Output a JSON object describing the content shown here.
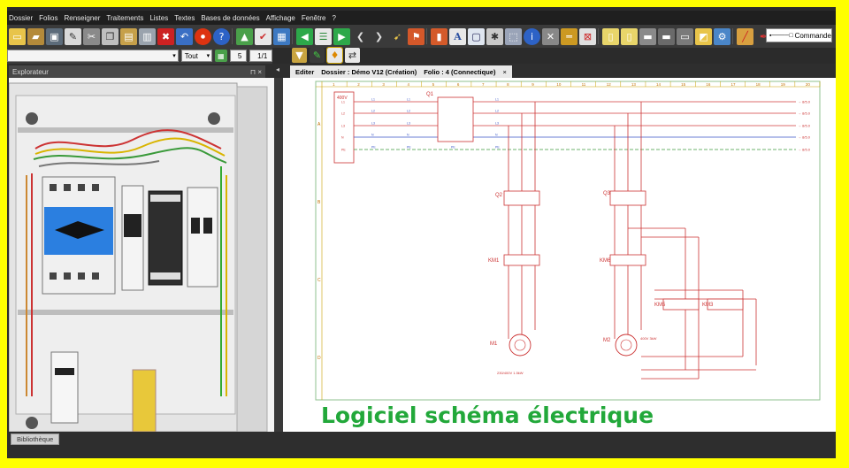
{
  "menu": [
    "Dossier",
    "Folios",
    "Renseigner",
    "Traitements",
    "Listes",
    "Textes",
    "Bases de données",
    "Affichage",
    "Fenêtre",
    "?"
  ],
  "command": {
    "label": "Commande"
  },
  "toolbar2": {
    "layer_select": "Tout",
    "folio_number": "5",
    "folio_count": "1/1"
  },
  "explorer": {
    "title": "Explorateur",
    "pin": "⊓ ×"
  },
  "document_tab": {
    "mode": "Editer",
    "dossier": "Dossier : Démo V12  (Création)",
    "folio": "Folio : 4  (Connectique)",
    "close": "×"
  },
  "bottom": {
    "library": "Bibliothèque"
  },
  "banner": {
    "text": "Logiciel  schéma électrique"
  },
  "schematic": {
    "columns": [
      "1",
      "2",
      "3",
      "4",
      "5",
      "6",
      "7",
      "8",
      "9",
      "10",
      "11",
      "12",
      "13",
      "14",
      "15",
      "16",
      "17",
      "18",
      "19",
      "20"
    ],
    "rows": [
      "A",
      "B",
      "C",
      "D"
    ],
    "voltage": "400V",
    "phases": [
      "L1",
      "L2",
      "L3",
      "N",
      "PE"
    ],
    "bus_labels": [
      "L1",
      "L2",
      "L3",
      "N",
      "PE"
    ],
    "destinations": [
      "→ 8/5.0",
      "→ 8/5.0",
      "→ 8/5.0",
      "→ 8/5.0",
      "→ 8/5.0"
    ],
    "breakers": [
      "Q1",
      "Q2",
      "Q3"
    ],
    "contactors": [
      "KM1",
      "KM6",
      "KM5",
      "KM3"
    ],
    "motors": [
      {
        "tag": "M1",
        "note": "230/400V 1.5kW"
      },
      {
        "tag": "M2",
        "note": "400V 3kW"
      }
    ]
  },
  "colors": {
    "accent": "#22a83a",
    "border": "#ffff00",
    "bus_red": "#d23c3c",
    "bus_blue": "#3a55c8",
    "pe_green": "#3f9a3f"
  }
}
